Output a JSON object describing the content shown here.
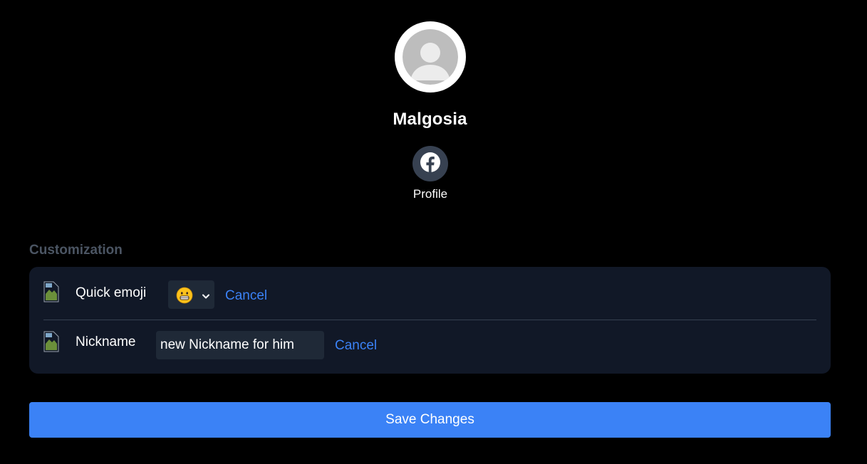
{
  "contact": {
    "name": "Malgosia",
    "avatar_icon": "default-user-avatar-icon"
  },
  "profile_action": {
    "icon": "facebook-icon",
    "label": "Profile"
  },
  "customization": {
    "title": "Customization",
    "rows": [
      {
        "icon": "broken-image-icon",
        "label": "Quick emoji",
        "selected_emoji": "grinning-face-emoji",
        "cancel_label": "Cancel"
      },
      {
        "icon": "broken-image-icon",
        "label": "Nickname",
        "input_value": "new Nickname for him",
        "cancel_label": "Cancel"
      }
    ]
  },
  "save_label": "Save Changes",
  "colors": {
    "background": "#000000",
    "card": "#111827",
    "input": "#1f2937",
    "accent": "#3b82f6",
    "muted_heading": "#4b5563",
    "icon_circle": "#374151"
  }
}
